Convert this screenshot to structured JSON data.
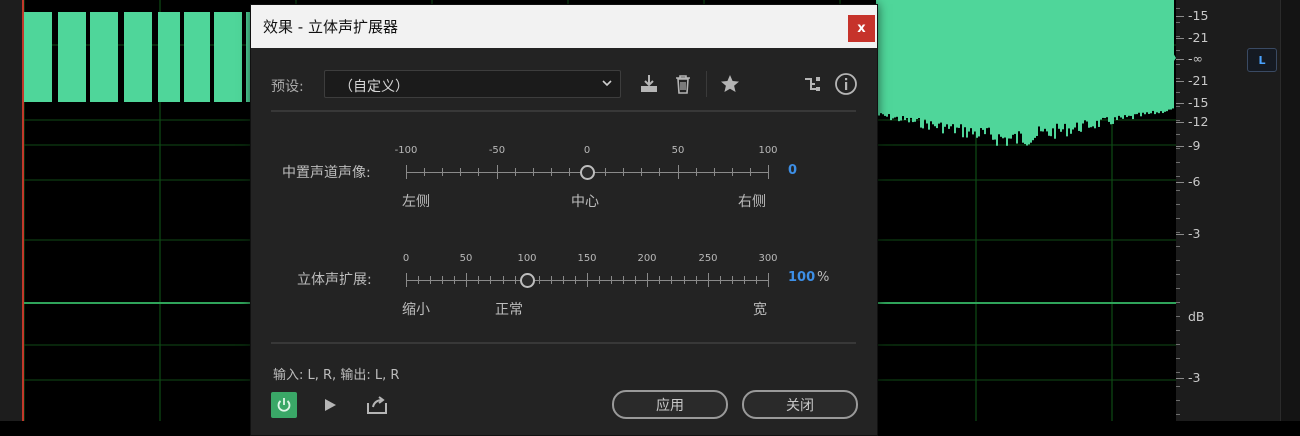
{
  "dialog": {
    "title": "效果 - 立体声扩展器",
    "close_label": "x",
    "preset": {
      "label": "预设:",
      "value": "（自定义）"
    },
    "toolbar": {
      "icons": [
        "download-icon",
        "trash-icon",
        "star-icon",
        "routing-icon",
        "info-icon"
      ]
    },
    "center_pan": {
      "label": "中置声道声像:",
      "scale": [
        "-100",
        "-50",
        "0",
        "50",
        "100"
      ],
      "value": "0",
      "value_fraction": 0.5,
      "under_labels": [
        "左侧",
        "中心",
        "右侧"
      ]
    },
    "stereo_expand": {
      "label": "立体声扩展:",
      "scale": [
        "0",
        "50",
        "100",
        "150",
        "200",
        "250",
        "300"
      ],
      "value": "100",
      "unit": "%",
      "value_fraction": 0.3333,
      "under_labels": [
        "缩小",
        "正常",
        "宽"
      ]
    },
    "io_text": "输入: L, R,   输出: L, R",
    "buttons": {
      "apply": "应用",
      "close": "关闭"
    },
    "bottom_icons": [
      "power-icon",
      "play-icon",
      "export-icon"
    ]
  },
  "ruler": {
    "labels_top": [
      "-15",
      "-21",
      "-∞",
      "-21",
      "-15",
      "-12",
      "-9",
      "-6",
      "-3"
    ],
    "unit": "dB",
    "labels_bottom": [
      "-3"
    ]
  },
  "channel_badge": "L",
  "colors": {
    "waveform": "#4fd69a",
    "power_active": "#3aa767",
    "accent_blue": "#3d8fe6",
    "close_red": "#c6332b"
  }
}
